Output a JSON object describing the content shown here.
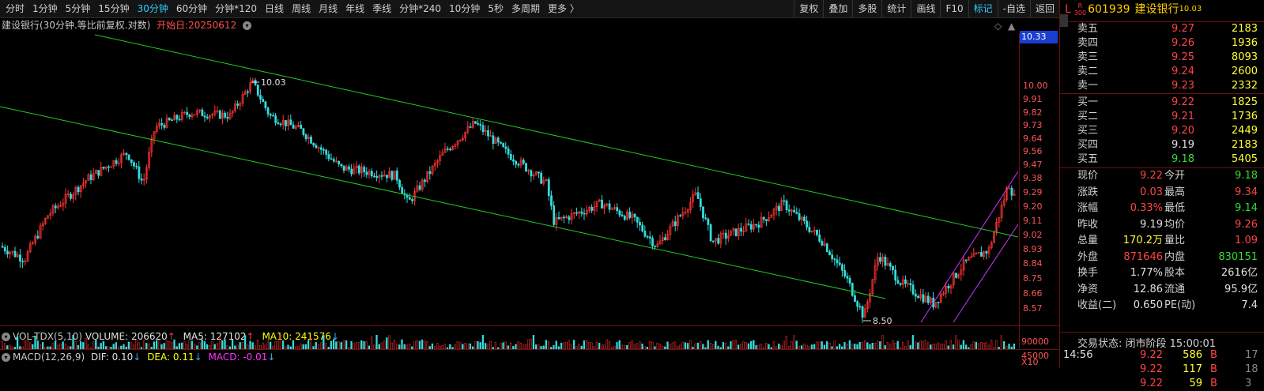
{
  "toolbar": {
    "periods": [
      "分时",
      "1分钟",
      "5分钟",
      "15分钟",
      "30分钟",
      "60分钟",
      "分钟*120",
      "日线",
      "周线",
      "月线",
      "年线",
      "季线",
      "分钟*240",
      "10分钟",
      "5秒",
      "多周期",
      "更多 〉"
    ],
    "active_period": "30分钟",
    "right_buttons": [
      "复权",
      "叠加",
      "多股",
      "统计",
      "画线",
      "F10",
      "标记",
      "-自选",
      "返回"
    ],
    "active_right": "标记"
  },
  "chart": {
    "title": "建设银行(30分钟.等比前复权.对数)",
    "start_label": "开始日:20250612",
    "high_label": "10.03",
    "low_label": "8.50",
    "price_badge": "10.33",
    "y_ticks": [
      "10.00",
      "9.91",
      "9.82",
      "9.73",
      "9.64",
      "9.56",
      "9.47",
      "9.38",
      "9.29",
      "9.20",
      "9.11",
      "9.02",
      "8.93",
      "8.84",
      "8.75",
      "8.66",
      "8.57"
    ],
    "price_min": 8.5,
    "price_max": 10.03
  },
  "volume": {
    "name": "VOL-TDX(5,10)",
    "volume_label": "VOLUME: 206620",
    "ma5_label": "MA5: 127102",
    "ma10_label": "MA10: 241576",
    "axis_labels": [
      "90000",
      "45000",
      "X10"
    ]
  },
  "macd": {
    "name": "MACD(12,26,9)",
    "dif_label": "DIF: 0.10",
    "dea_label": "DEA: 0.11",
    "macd_label": "MACD: -0.01"
  },
  "quote": {
    "market_letter": "L",
    "badge_top": "R",
    "badge_bottom": "300",
    "code": "601939",
    "name": "建设银行",
    "last_price": "10.03",
    "asks": [
      {
        "label": "卖五",
        "price": "9.27",
        "qty": "2183"
      },
      {
        "label": "卖四",
        "price": "9.26",
        "qty": "1936"
      },
      {
        "label": "卖三",
        "price": "9.25",
        "qty": "8093"
      },
      {
        "label": "卖二",
        "price": "9.24",
        "qty": "2600"
      },
      {
        "label": "卖一",
        "price": "9.23",
        "qty": "2332"
      }
    ],
    "bids": [
      {
        "label": "买一",
        "price": "9.22",
        "qty": "1825"
      },
      {
        "label": "买二",
        "price": "9.21",
        "qty": "1736"
      },
      {
        "label": "买三",
        "price": "9.20",
        "qty": "2449"
      },
      {
        "label": "买四",
        "price": "9.19",
        "qty": "2183"
      },
      {
        "label": "买五",
        "price": "9.18",
        "qty": "5405"
      }
    ],
    "stats": [
      {
        "l1": "现价",
        "v1": "9.22",
        "c1": "red",
        "l2": "今开",
        "v2": "9.18",
        "c2": "green"
      },
      {
        "l1": "涨跌",
        "v1": "0.03",
        "c1": "red",
        "l2": "最高",
        "v2": "9.34",
        "c2": "red"
      },
      {
        "l1": "涨幅",
        "v1": "0.33%",
        "c1": "red",
        "l2": "最低",
        "v2": "9.14",
        "c2": "green"
      },
      {
        "l1": "昨收",
        "v1": "9.19",
        "c1": "white",
        "l2": "均价",
        "v2": "9.26",
        "c2": "red"
      },
      {
        "l1": "总量",
        "v1": "170.2万",
        "c1": "yellow",
        "l2": "量比",
        "v2": "1.09",
        "c2": "red"
      },
      {
        "l1": "外盘",
        "v1": "871646",
        "c1": "red",
        "l2": "内盘",
        "v2": "830151",
        "c2": "green"
      },
      {
        "l1": "换手",
        "v1": "1.77%",
        "c1": "white",
        "l2": "股本",
        "v2": "2616亿",
        "c2": "white"
      },
      {
        "l1": "净资",
        "v1": "12.86",
        "c1": "white",
        "l2": "流通",
        "v2": "95.9亿",
        "c2": "white"
      },
      {
        "l1": "收益(二)",
        "v1": "0.650",
        "c1": "white",
        "l2": "PE(动)",
        "v2": "7.4",
        "c2": "white"
      }
    ],
    "trade_state": "交易状态: 闭市阶段 15:00:01",
    "ticks": [
      {
        "time": "14:56",
        "price": "9.22",
        "vol": "586",
        "side": "B",
        "num": "17"
      },
      {
        "time": "",
        "price": "9.22",
        "vol": "117",
        "side": "B",
        "num": "18"
      },
      {
        "time": "",
        "price": "9.22",
        "vol": "59",
        "side": "B",
        "num": "3"
      }
    ]
  },
  "colors": {
    "up": "#ff3333",
    "down": "#33dddd",
    "channel": "#22cc22",
    "trend": "#cc33ff",
    "background": "#000000"
  }
}
